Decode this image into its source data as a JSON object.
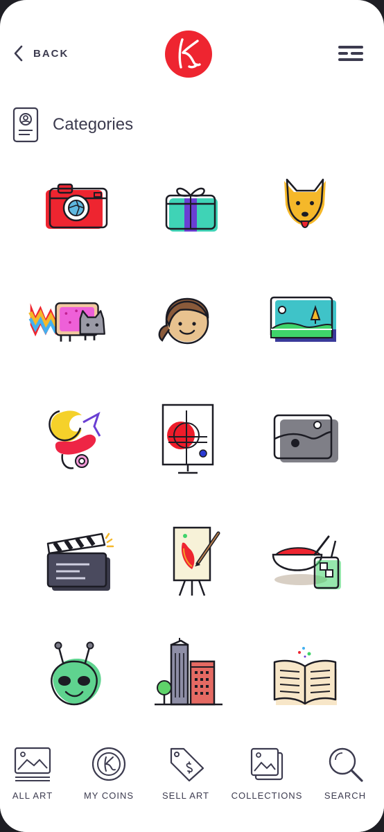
{
  "header": {
    "back_label": "BACK"
  },
  "page": {
    "title": "Categories"
  },
  "categories": [
    {
      "icon": "camera-icon"
    },
    {
      "icon": "gift-icon"
    },
    {
      "icon": "fox-icon"
    },
    {
      "icon": "nyan-cat-icon"
    },
    {
      "icon": "girl-face-icon"
    },
    {
      "icon": "landscape-icon"
    },
    {
      "icon": "abstract-art-icon"
    },
    {
      "icon": "abstract-easel-icon"
    },
    {
      "icon": "photo-icon"
    },
    {
      "icon": "clapperboard-icon"
    },
    {
      "icon": "painting-easel-icon"
    },
    {
      "icon": "food-drink-icon"
    },
    {
      "icon": "alien-icon"
    },
    {
      "icon": "city-buildings-icon"
    },
    {
      "icon": "open-book-icon"
    }
  ],
  "tabbar": {
    "all_art": "ALL ART",
    "my_coins": "MY COINS",
    "sell_art": "SELL ART",
    "collections": "COLLECTIONS",
    "search": "SEARCH"
  },
  "colors": {
    "brand": "#ee2530",
    "text": "#3c3b4f",
    "ink": "#1c1c24"
  }
}
